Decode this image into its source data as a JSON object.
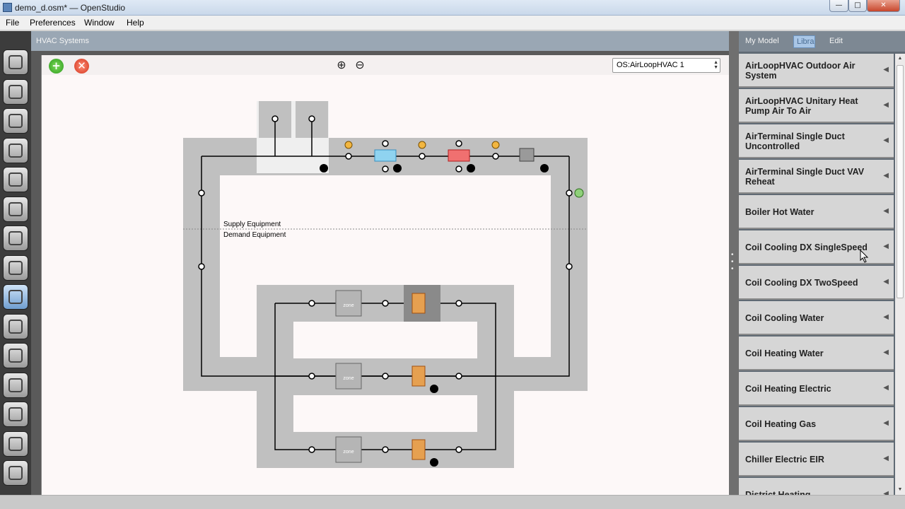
{
  "window": {
    "title": "demo_d.osm* — OpenStudio",
    "min_glyph": "—",
    "max_glyph": "□",
    "close_glyph": "✕"
  },
  "menu": {
    "items": [
      "File",
      "Preferences",
      "Window",
      "Help"
    ]
  },
  "sidebar_tools": [
    "site-icon",
    "schedules-icon",
    "constructions-icon",
    "loads-icon",
    "space-types-icon",
    "building-stories-icon",
    "facility-icon",
    "thermal-zones-icon",
    "hvac-systems-icon",
    "building-summary-icon",
    "measures-icon",
    "simulation-settings-icon",
    "scripts-icon",
    "run-icon",
    "results-icon"
  ],
  "main": {
    "header": "HVAC Systems",
    "toolbar": {
      "add": "+",
      "remove": "✕",
      "zoom_in": "⊕",
      "zoom_out": "⊖"
    },
    "loop_select": {
      "value": "OS:AirLoopHVAC 1",
      "spin_up": "▲",
      "spin_down": "▼"
    },
    "diagram": {
      "supply_label": "Supply Equipment",
      "demand_label": "Demand Equipment",
      "zone_label": "zone",
      "zone_count": 3
    }
  },
  "right_panel": {
    "tabs": [
      "My Model",
      "Library",
      "Edit"
    ],
    "active_tab": "Library",
    "items": [
      "AirLoopHVAC Outdoor Air System",
      "AirLoopHVAC Unitary Heat Pump Air To Air",
      "AirTerminal Single Duct Uncontrolled",
      "AirTerminal Single Duct VAV Reheat",
      "Boiler Hot Water",
      "Coil Cooling DX SingleSpeed",
      "Coil Cooling DX TwoSpeed",
      "Coil Cooling Water",
      "Coil Heating Water",
      "Coil Heating Electric",
      "Coil Heating Gas",
      "Chiller Electric EIR",
      "District Heating"
    ],
    "item_arrow": "◀"
  },
  "splitter_dots": "• • •",
  "scroll": {
    "up": "▲",
    "down": "▼"
  },
  "colors": {
    "panel_bg": "#d6d6d6",
    "loop_gray": "#c0c0c0",
    "canvas_bg": "#fdf8f8",
    "accent": "#a9c6e6"
  }
}
